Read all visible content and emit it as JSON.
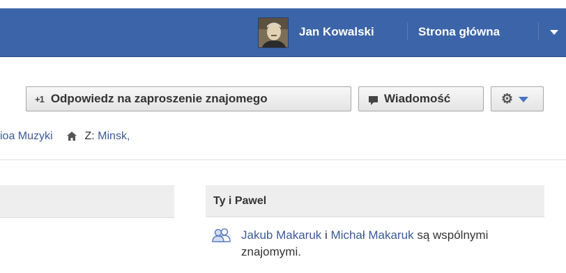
{
  "nav": {
    "user_name": "Jan Kowalski",
    "home_label": "Strona główna",
    "avatar_alt": "avatar"
  },
  "actions": {
    "respond_icon": "+1",
    "respond_label": "Odpowiedz na zaproszenie znajomego",
    "message_label": "Wiadomość",
    "settings_icon": "gear-icon",
    "settings_caret": "chevron-down-icon"
  },
  "profile_info": {
    "school_fragment": "ioa Muzyki",
    "hometown_prefix": "Z:",
    "hometown": "Minsk,"
  },
  "mutual": {
    "header": "Ty i Pawel",
    "friend1": "Jakub Makaruk",
    "connector": "i",
    "friend2": "Michał Makaruk",
    "text_after": "są wspólnymi znajomymi."
  },
  "colors": {
    "nav_bg": "#3c64a8",
    "link": "#3b5998"
  }
}
